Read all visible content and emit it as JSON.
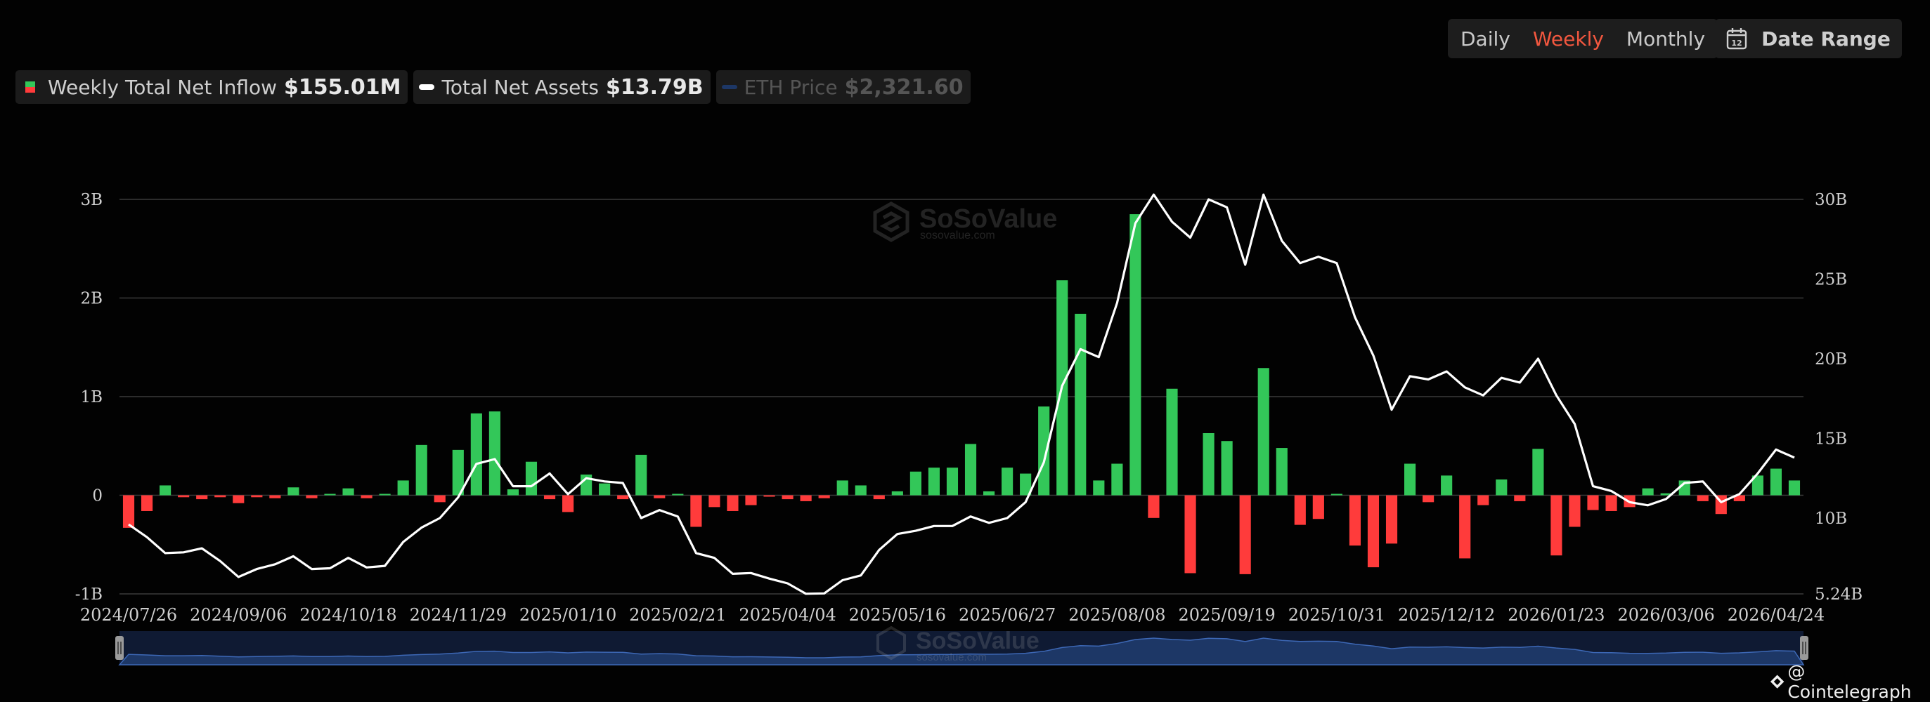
{
  "controls": {
    "periods": [
      "Daily",
      "Weekly",
      "Monthly"
    ],
    "active_period": "Weekly",
    "date_range_label": "Date Range",
    "date_range_icon": "calendar-icon",
    "calendar_number": "12"
  },
  "legend": {
    "inflow": {
      "label": "Weekly Total Net Inflow",
      "value": "$155.01M",
      "icon": "inflow-swatch-icon"
    },
    "assets": {
      "label": "Total Net Assets",
      "value": "$13.79B",
      "icon": "assets-swatch-icon"
    },
    "eth": {
      "label": "ETH Price",
      "value": "$2,321.60",
      "icon": "eth-swatch-icon"
    }
  },
  "watermark": {
    "brand": "SoSoValue",
    "url": "sosovalue.com"
  },
  "credit": {
    "text": "@ Cointelegraph",
    "icon": "cointelegraph-icon"
  },
  "colors": {
    "positive": "#33c759",
    "negative": "#ff3b3b",
    "line": "#ffffff",
    "active_tab": "#f2573f",
    "navigator": "#1d3766"
  },
  "chart_data": {
    "type": "bar",
    "x_tick_labels": [
      "2024/07/26",
      "2024/09/06",
      "2024/10/18",
      "2024/11/29",
      "2025/01/10",
      "2025/02/21",
      "2025/04/04",
      "2025/05/16",
      "2025/06/27",
      "2025/08/08",
      "2025/09/19",
      "2025/10/31",
      "2025/12/12",
      "2026/01/23",
      "2026/03/06",
      "2026/04/24"
    ],
    "y_left": {
      "ticks": [
        -1,
        0,
        1,
        2,
        3
      ],
      "tick_labels": [
        "-1B",
        "0",
        "1B",
        "2B",
        "3B"
      ],
      "range": [
        -1,
        3
      ],
      "unit": "B"
    },
    "y_right": {
      "ticks": [
        5.24,
        10,
        15,
        20,
        25,
        30
      ],
      "tick_labels": [
        "5.24B",
        "10B",
        "15B",
        "20B",
        "25B",
        "30B"
      ],
      "range": [
        5.24,
        30
      ]
    },
    "grid": true,
    "series": [
      {
        "name": "Weekly Total Net Inflow",
        "type": "bar",
        "axis": "left",
        "values": [
          -0.33,
          -0.16,
          0.1,
          -0.02,
          -0.04,
          -0.02,
          -0.08,
          -0.02,
          -0.03,
          0.08,
          -0.03,
          0.0,
          0.07,
          -0.03,
          0.01,
          0.15,
          0.51,
          -0.07,
          0.46,
          0.83,
          0.85,
          0.06,
          0.34,
          -0.04,
          -0.17,
          0.21,
          0.12,
          -0.04,
          0.41,
          -0.03,
          0.0,
          -0.32,
          -0.12,
          -0.16,
          -0.1,
          -0.01,
          -0.04,
          -0.06,
          -0.03,
          0.15,
          0.1,
          -0.04,
          0.04,
          0.24,
          0.28,
          0.28,
          0.52,
          0.04,
          0.28,
          0.22,
          0.9,
          2.18,
          1.84,
          0.15,
          0.32,
          2.85,
          -0.23,
          1.08,
          -0.79,
          0.63,
          0.55,
          -0.8,
          1.29,
          0.48,
          -0.3,
          -0.24,
          0.01,
          -0.51,
          -0.73,
          -0.49,
          0.32,
          -0.07,
          0.2,
          -0.64,
          -0.1,
          0.16,
          -0.06,
          0.47,
          -0.61,
          -0.32,
          -0.15,
          -0.16,
          -0.12,
          0.07,
          0.02,
          0.15,
          -0.06,
          -0.19,
          -0.06,
          0.2,
          0.27,
          0.15
        ]
      },
      {
        "name": "Total Net Assets",
        "type": "line",
        "axis": "right",
        "values": [
          9.6,
          8.8,
          7.8,
          7.85,
          8.1,
          7.3,
          6.3,
          6.8,
          7.1,
          7.6,
          6.8,
          6.85,
          7.5,
          6.9,
          7.0,
          8.5,
          9.4,
          10.0,
          11.3,
          13.4,
          13.7,
          12.0,
          12.0,
          12.8,
          11.5,
          12.5,
          12.3,
          12.2,
          10.0,
          10.5,
          10.1,
          7.8,
          7.5,
          6.5,
          6.55,
          6.2,
          5.9,
          5.25,
          5.27,
          6.1,
          6.4,
          8.0,
          9.0,
          9.2,
          9.5,
          9.5,
          10.1,
          9.7,
          10.0,
          11.0,
          13.5,
          18.3,
          20.6,
          20.1,
          23.5,
          28.5,
          30.3,
          28.6,
          27.6,
          30.0,
          29.5,
          25.9,
          30.3,
          27.4,
          26.0,
          26.4,
          26.0,
          22.6,
          20.2,
          16.8,
          18.9,
          18.7,
          19.2,
          18.2,
          17.7,
          18.8,
          18.5,
          20.0,
          17.7,
          15.9,
          12.0,
          11.7,
          11.0,
          10.8,
          11.2,
          12.2,
          12.3,
          11.0,
          11.5,
          12.8,
          14.3,
          13.79
        ]
      },
      {
        "name": "ETH Price",
        "type": "line",
        "visible": false,
        "values": []
      }
    ]
  }
}
